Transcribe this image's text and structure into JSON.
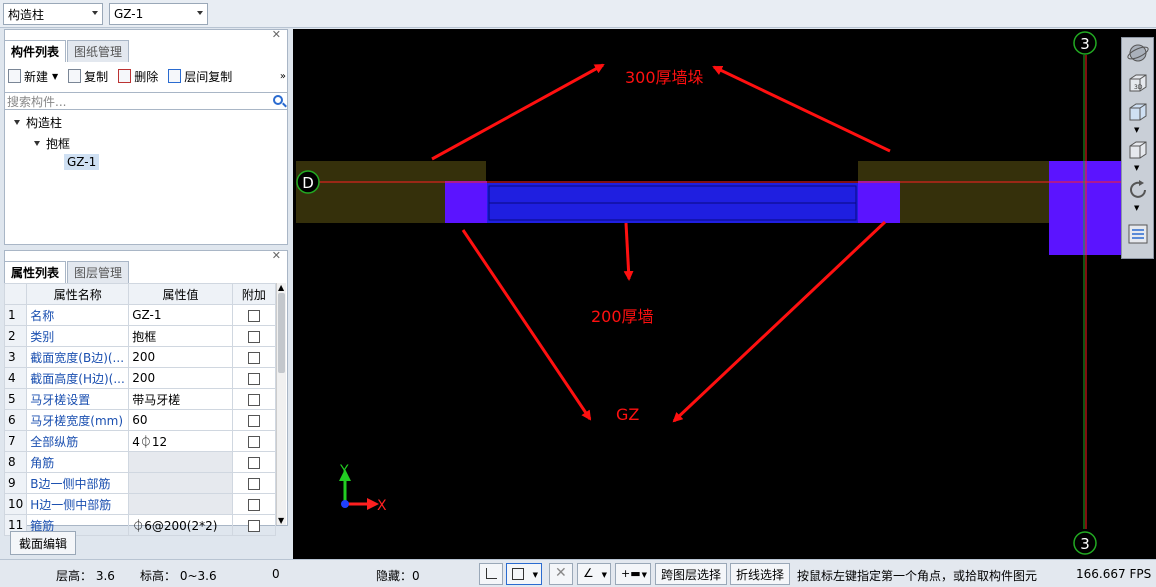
{
  "toolbar": {
    "type_select": "构造柱",
    "item_select": "GZ-1"
  },
  "component_panel": {
    "tabs": [
      "构件列表",
      "图纸管理"
    ],
    "actions": [
      "新建",
      "复制",
      "删除",
      "层间复制"
    ],
    "search_placeholder": "搜索构件...",
    "tree": {
      "root": "构造柱",
      "child": "抱框",
      "leaf": "GZ-1"
    }
  },
  "property_panel": {
    "tabs": [
      "属性列表",
      "图层管理"
    ],
    "headers": [
      "属性名称",
      "属性值",
      "附加"
    ],
    "rows": [
      {
        "num": "1",
        "name": "名称",
        "value": "GZ-1"
      },
      {
        "num": "2",
        "name": "类别",
        "value": "抱框"
      },
      {
        "num": "3",
        "name": "截面宽度(B边)(...",
        "value": "200"
      },
      {
        "num": "4",
        "name": "截面高度(H边)(...",
        "value": "200"
      },
      {
        "num": "5",
        "name": "马牙槎设置",
        "value": "带马牙槎"
      },
      {
        "num": "6",
        "name": "马牙槎宽度(mm)",
        "value": "60"
      },
      {
        "num": "7",
        "name": "全部纵筋",
        "value": "4⏀12"
      },
      {
        "num": "8",
        "name": "角筋",
        "value": ""
      },
      {
        "num": "9",
        "name": "B边一侧中部筋",
        "value": ""
      },
      {
        "num": "10",
        "name": "H边一侧中部筋",
        "value": ""
      },
      {
        "num": "11",
        "name": "箍筋",
        "value": "⏀6@200(2*2)"
      }
    ],
    "section_edit": "截面编辑"
  },
  "viewport": {
    "axis_top": "3",
    "axis_bottom": "3",
    "axis_left": "D",
    "annotation_wall_pier": "300厚墙垛",
    "annotation_wall": "200厚墙",
    "annotation_gz": "GZ",
    "axis_x": "X",
    "axis_y": "Y",
    "colors": {
      "background": "#000000",
      "wall_pier": "#35300b",
      "column": "#5b14ff",
      "wall": "#1f1fe0",
      "arrow": "#ff1010",
      "axis_line_red": "#ff2020",
      "axis_line_green": "#22aa22"
    }
  },
  "view_tools": {
    "icons": [
      "orbit-icon",
      "3d-view-icon",
      "view-box-icon",
      "cube-icon",
      "rotate-icon",
      "layer-list-icon"
    ],
    "cube_label": "3D"
  },
  "status_bar": {
    "floor_height": "层高： 3.6",
    "elevation": "标高： 0~3.6",
    "zero": "0",
    "hidden": "隐藏：0",
    "cross_layer_select": "跨图层选择",
    "polyline_select": "折线选择",
    "hint": "按鼠标左键指定第一个角点，或拾取构件图元",
    "fps": "166.667 FPS"
  }
}
